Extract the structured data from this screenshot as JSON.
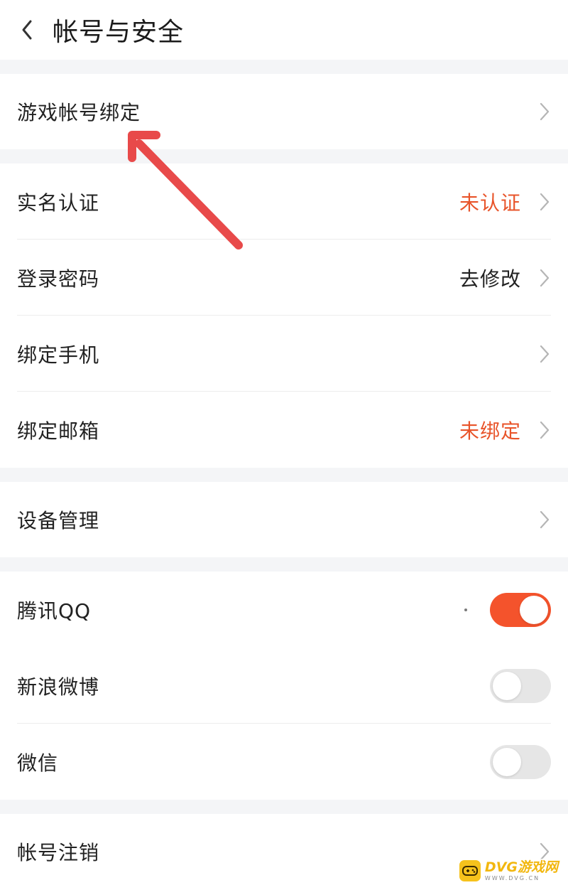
{
  "header": {
    "title": "帐号与安全"
  },
  "groups": {
    "game_binding": {
      "label": "游戏帐号绑定"
    },
    "security": {
      "realname": {
        "label": "实名认证",
        "value": "未认证"
      },
      "password": {
        "label": "登录密码",
        "value": "去修改"
      },
      "phone": {
        "label": "绑定手机"
      },
      "email": {
        "label": "绑定邮箱",
        "value": "未绑定"
      }
    },
    "device": {
      "label": "设备管理"
    },
    "social": {
      "qq": {
        "label": "腾讯QQ",
        "enabled": true
      },
      "weibo": {
        "label": "新浪微博",
        "enabled": false
      },
      "wechat": {
        "label": "微信",
        "enabled": false
      }
    },
    "cancel": {
      "label": "帐号注销"
    }
  },
  "watermark": {
    "main": "DVG游戏网",
    "sub": "WWW.DVG.CN"
  },
  "colors": {
    "accent": "#f4532c",
    "warning_text": "#e8542a",
    "annotation_arrow": "#e84a4a",
    "watermark": "#f6c21c"
  },
  "icons": {
    "back": "chevron-left-icon",
    "row": "chevron-right-icon",
    "annotation": "arrow-annotation-icon",
    "watermark": "gamepad-icon"
  }
}
